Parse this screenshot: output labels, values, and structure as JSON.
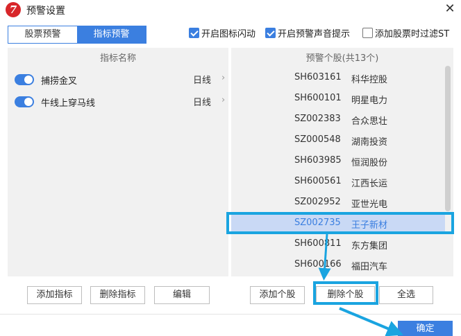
{
  "window": {
    "title": "预警设置",
    "logo_letter": "7",
    "close_symbol": "✕"
  },
  "tabs": [
    {
      "label": "股票预警",
      "active": false
    },
    {
      "label": "指标预警",
      "active": true
    }
  ],
  "options": [
    {
      "label": "开启图标闪动",
      "checked": true
    },
    {
      "label": "开启预警声音提示",
      "checked": true
    },
    {
      "label": "添加股票时过滤ST",
      "checked": false
    }
  ],
  "left_panel": {
    "header": "指标名称",
    "indicators": [
      {
        "name": "捕捞金叉",
        "period": "日线",
        "enabled": true
      },
      {
        "name": "牛线上穿马线",
        "period": "日线",
        "enabled": true
      }
    ],
    "arrow_symbol": "›"
  },
  "right_panel": {
    "header": "预警个股(共13个)",
    "stocks": [
      {
        "code": "SH603161",
        "name": "科华控股"
      },
      {
        "code": "SH600101",
        "name": "明星电力"
      },
      {
        "code": "SZ002383",
        "name": "合众思壮"
      },
      {
        "code": "SZ000548",
        "name": "湖南投资"
      },
      {
        "code": "SH603985",
        "name": "恒润股份"
      },
      {
        "code": "SH600561",
        "name": "江西长运"
      },
      {
        "code": "SZ002952",
        "name": "亚世光电"
      },
      {
        "code": "SZ002735",
        "name": "王子新材"
      },
      {
        "code": "SH600811",
        "name": "东方集团"
      },
      {
        "code": "SH600166",
        "name": "福田汽车"
      }
    ],
    "selected_index": 7
  },
  "buttons": {
    "add_indicator": "添加指标",
    "delete_indicator": "删除指标",
    "edit": "编辑",
    "add_stock": "添加个股",
    "delete_stock": "删除个股",
    "select_all": "全选",
    "confirm": "确定"
  },
  "colors": {
    "accent": "#3b7fe0",
    "annotation": "#1aa4e0",
    "selection": "#c9d9f5",
    "logo": "#d8262a"
  }
}
